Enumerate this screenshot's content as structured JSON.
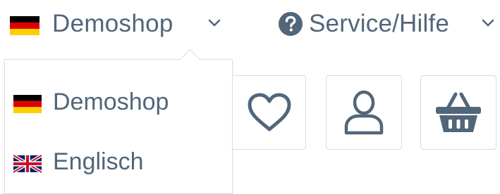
{
  "header": {
    "shop_switcher": {
      "label": "Demoshop",
      "flag_icon": "flag-de-icon",
      "chevron_icon": "chevron-down-icon"
    },
    "service_menu": {
      "label": "Service/Hilfe",
      "icon": "question-circle-icon",
      "chevron_icon": "chevron-down-icon"
    }
  },
  "shop_dropdown": {
    "items": [
      {
        "label": "Demoshop",
        "flag_icon": "flag-de-icon"
      },
      {
        "label": "Englisch",
        "flag_icon": "flag-uk-icon"
      }
    ]
  },
  "actions": {
    "wishlist_icon": "heart-icon",
    "account_icon": "user-icon",
    "cart_icon": "basket-icon"
  },
  "colors": {
    "text": "#52667a",
    "border": "#dadae5",
    "background": "#ffffff"
  }
}
